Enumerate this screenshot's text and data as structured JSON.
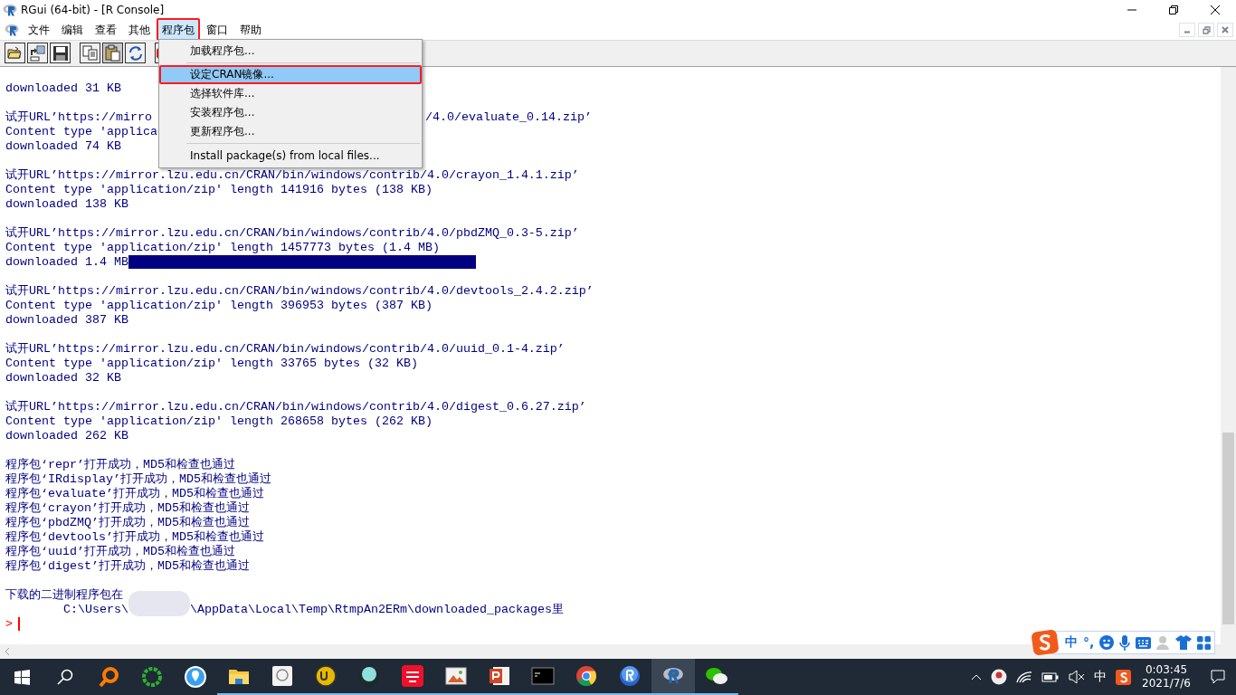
{
  "window": {
    "title": "RGui (64-bit) - [R Console]"
  },
  "menu_bar": [
    {
      "label": "文件",
      "selected": false,
      "highlighted": false
    },
    {
      "label": "编辑",
      "selected": false,
      "highlighted": false
    },
    {
      "label": "查看",
      "selected": false,
      "highlighted": false
    },
    {
      "label": "其他",
      "selected": false,
      "highlighted": false
    },
    {
      "label": "程序包",
      "selected": true,
      "highlighted": true
    },
    {
      "label": "窗口",
      "selected": false,
      "highlighted": false
    },
    {
      "label": "帮助",
      "selected": false,
      "highlighted": false
    }
  ],
  "dropdown": [
    {
      "kind": "item",
      "label": "加载程序包...",
      "selected": false,
      "highlighted": false
    },
    {
      "kind": "separator"
    },
    {
      "kind": "item",
      "label": "设定CRAN镜像...",
      "selected": true,
      "highlighted": true
    },
    {
      "kind": "item",
      "label": "选择软件库...",
      "selected": false,
      "highlighted": false
    },
    {
      "kind": "item",
      "label": "安装程序包...",
      "selected": false,
      "highlighted": false
    },
    {
      "kind": "item",
      "label": "更新程序包...",
      "selected": false,
      "highlighted": false
    },
    {
      "kind": "separator"
    },
    {
      "kind": "item",
      "label": "Install package(s) from local files...",
      "selected": false,
      "highlighted": false
    }
  ],
  "console": {
    "blocks": [
      [
        {
          "kind": "plain",
          "text": "downloaded 31 KB"
        }
      ],
      [
        {
          "kind": "covered",
          "text": "试开URL’https://mirro",
          "tail": "/4.0/evaluate_0.14.zip’"
        },
        {
          "kind": "plain",
          "text": "Content type 'applica"
        },
        {
          "kind": "plain",
          "text": "downloaded 74 KB"
        }
      ],
      [
        {
          "kind": "plain",
          "text": "试开URL’https://mirror.lzu.edu.cn/CRAN/bin/windows/contrib/4.0/crayon_1.4.1.zip’"
        },
        {
          "kind": "plain",
          "text": "Content type 'application/zip' length 141916 bytes (138 KB)"
        },
        {
          "kind": "plain",
          "text": "downloaded 138 KB"
        }
      ],
      [
        {
          "kind": "plain",
          "text": "试开URL’https://mirror.lzu.edu.cn/CRAN/bin/windows/contrib/4.0/pbdZMQ_0.3-5.zip’"
        },
        {
          "kind": "plain",
          "text": "Content type 'application/zip' length 1457773 bytes (1.4 MB)"
        },
        {
          "kind": "selection",
          "text": "downloaded 1.4 MB",
          "selected": true
        }
      ],
      [
        {
          "kind": "plain",
          "text": "试开URL’https://mirror.lzu.edu.cn/CRAN/bin/windows/contrib/4.0/devtools_2.4.2.zip’"
        },
        {
          "kind": "plain",
          "text": "Content type 'application/zip' length 396953 bytes (387 KB)"
        },
        {
          "kind": "plain",
          "text": "downloaded 387 KB"
        }
      ],
      [
        {
          "kind": "plain",
          "text": "试开URL’https://mirror.lzu.edu.cn/CRAN/bin/windows/contrib/4.0/uuid_0.1-4.zip’"
        },
        {
          "kind": "plain",
          "text": "Content type 'application/zip' length 33765 bytes (32 KB)"
        },
        {
          "kind": "plain",
          "text": "downloaded 32 KB"
        }
      ],
      [
        {
          "kind": "plain",
          "text": "试开URL’https://mirror.lzu.edu.cn/CRAN/bin/windows/contrib/4.0/digest_0.6.27.zip’"
        },
        {
          "kind": "plain",
          "text": "Content type 'application/zip' length 268658 bytes (262 KB)"
        },
        {
          "kind": "plain",
          "text": "downloaded 262 KB"
        }
      ],
      [
        {
          "kind": "plain",
          "text": "程序包‘repr’打开成功，MD5和检查也通过"
        },
        {
          "kind": "plain",
          "text": "程序包‘IRdisplay’打开成功，MD5和检查也通过"
        },
        {
          "kind": "plain",
          "text": "程序包‘evaluate’打开成功，MD5和检查也通过"
        },
        {
          "kind": "plain",
          "text": "程序包‘crayon’打开成功，MD5和检查也通过"
        },
        {
          "kind": "plain",
          "text": "程序包‘pbdZMQ’打开成功，MD5和检查也通过"
        },
        {
          "kind": "plain",
          "text": "程序包‘devtools’打开成功，MD5和检查也通过"
        },
        {
          "kind": "plain",
          "text": "程序包‘uuid’打开成功，MD5和检查也通过"
        },
        {
          "kind": "plain",
          "text": "程序包‘digest’打开成功，MD5和检查也通过"
        }
      ],
      [
        {
          "kind": "plain",
          "text": "下载的二进制程序包在"
        },
        {
          "kind": "redacted",
          "text": "        C:\\Users\\",
          "tail": "\\AppData\\Local\\Temp\\RtmpAn2ERm\\downloaded_packages里"
        }
      ]
    ],
    "prompt": ">"
  },
  "ime_bar": {
    "mode": "中",
    "punctuation": "°,"
  },
  "taskbar": {
    "tray_language": "中",
    "time": "0:03:45",
    "date": "2021/7/6"
  }
}
